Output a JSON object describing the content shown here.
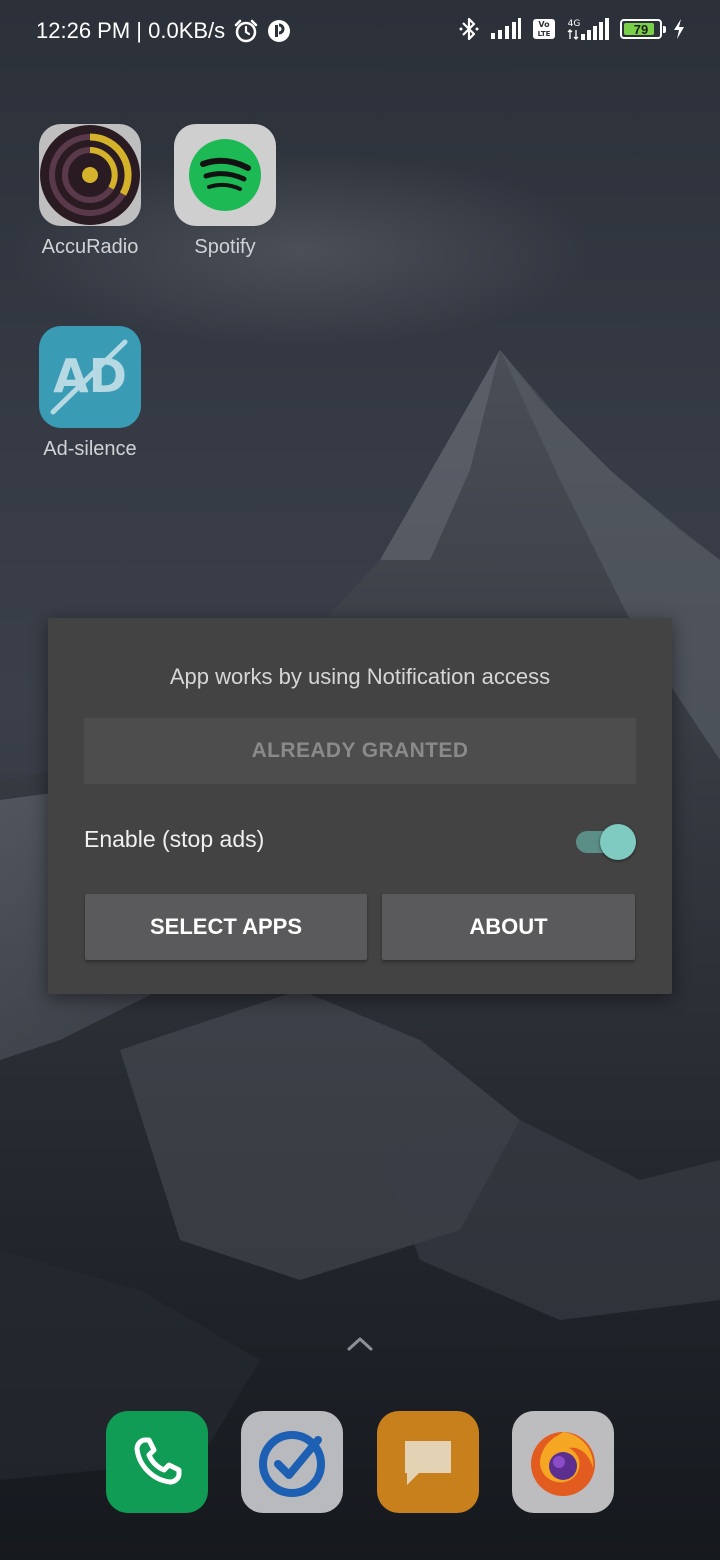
{
  "status_bar": {
    "time_speed": "12:26 PM | 0.0KB/s",
    "alarm_icon": "alarm-clock-icon",
    "notif_icon": "app-notification-icon",
    "bluetooth_icon": "bluetooth-icon",
    "signal_icon": "signal-bars-icon",
    "volte_badge": "Vo LTE",
    "network_type": "4G",
    "battery_level": "79",
    "battery_percent": 79,
    "charging_icon": "lightning-bolt-icon"
  },
  "home_apps": [
    {
      "label": "AccuRadio",
      "icon": "accuradio-icon"
    },
    {
      "label": "Spotify",
      "icon": "spotify-icon"
    },
    {
      "label": "Ad-silence",
      "icon": "ad-silence-icon"
    }
  ],
  "dialog": {
    "title": "App works by using Notification access",
    "granted_button": "ALREADY GRANTED",
    "enable_label": "Enable (stop ads)",
    "enable_on": true,
    "select_apps_button": "SELECT APPS",
    "about_button": "ABOUT"
  },
  "dock": [
    {
      "icon": "phone-icon"
    },
    {
      "icon": "task-check-icon"
    },
    {
      "icon": "messages-icon"
    },
    {
      "icon": "firefox-icon"
    }
  ],
  "colors": {
    "accent_switch": "#7fcbc2",
    "dialog_bg": "#434343"
  }
}
